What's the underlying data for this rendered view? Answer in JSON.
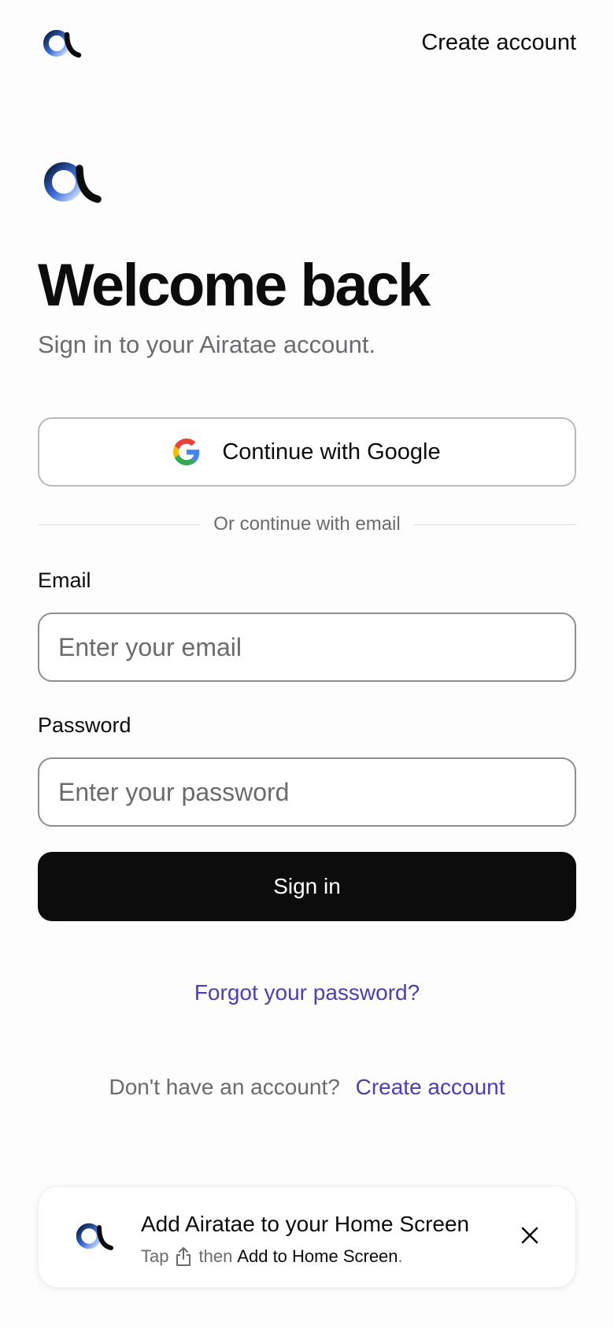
{
  "header": {
    "create_account_label": "Create account"
  },
  "hero": {
    "title": "Welcome back",
    "subtitle": "Sign in to your Airatae account."
  },
  "google_button": {
    "label": "Continue with Google"
  },
  "divider": {
    "text": "Or continue with email"
  },
  "form": {
    "email_label": "Email",
    "email_placeholder": "Enter your email",
    "email_value": "",
    "password_label": "Password",
    "password_placeholder": "Enter your password",
    "password_value": "",
    "submit_label": "Sign in"
  },
  "links": {
    "forgot_password": "Forgot your password?",
    "no_account_prompt": "Don't have an account?",
    "create_account": "Create account"
  },
  "install_banner": {
    "title": "Add Airatae to your Home Screen",
    "tap": "Tap",
    "then": "then",
    "action": "Add to Home Screen",
    "period": "."
  },
  "icons": {
    "logo": "airatae-logo-icon",
    "google": "google-g-icon",
    "share": "share-icon",
    "close": "close-icon"
  },
  "colors": {
    "link": "#4a40b0",
    "primary_button": "#0c0c0d",
    "muted_text": "#6b6b6f"
  }
}
